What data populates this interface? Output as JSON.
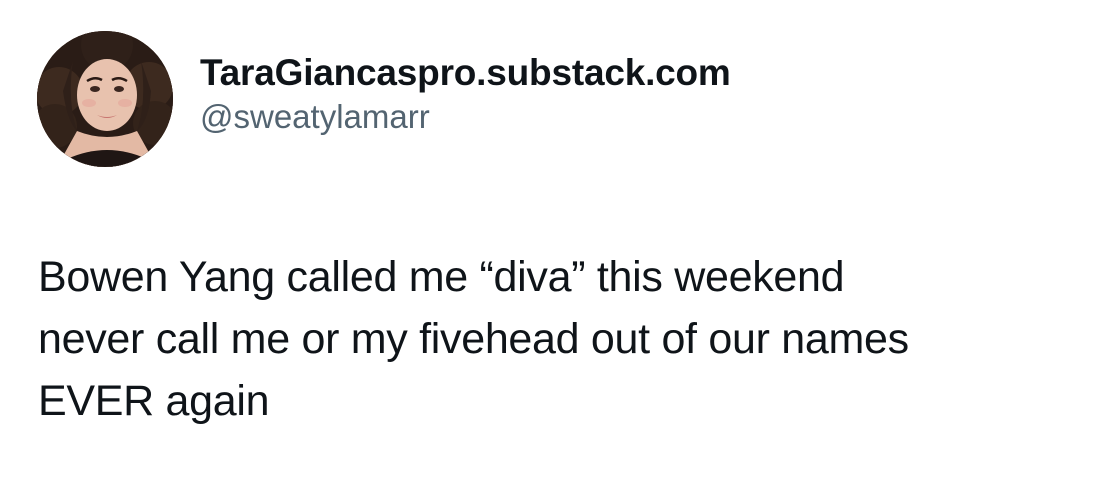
{
  "author": {
    "display_name": "TaraGiancaspro.substack.com",
    "handle": "@sweatylamarr"
  },
  "tweet": {
    "lines": [
      "Bowen Yang called me “diva” this weekend",
      "never call me or my fivehead out of our names",
      "EVER again"
    ]
  },
  "colors": {
    "text_primary": "#0f1419",
    "text_secondary": "#536471",
    "background": "#ffffff"
  }
}
